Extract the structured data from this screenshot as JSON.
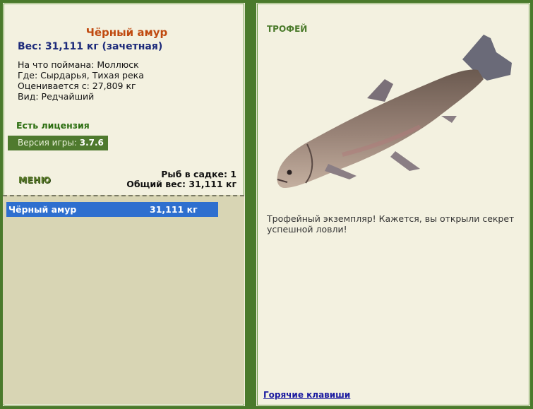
{
  "left": {
    "fish_name": "Чёрный амур",
    "weight_line": "Вес: 31,111 кг (зачетная)",
    "bait_line": "На что поймана: Моллюск",
    "location_line": "Где: Сырдарья, Тихая река",
    "estimated_line": "Оценивается с: 27,809 кг",
    "rarity_line": "Вид: Редчайший",
    "license": "Есть лицензия",
    "version_label": "Версия игры:",
    "version_value": "3.7.6",
    "menu_label": "МЕНЮ",
    "fish_count": "Рыб в садке: 1",
    "total_weight": "Общий вес: 31,111 кг",
    "catch_list": [
      {
        "name": "Чёрный амур",
        "weight": "31,111 кг"
      }
    ]
  },
  "right": {
    "trophy_label": "ТРОФЕЙ",
    "description": "Трофейный экземпляр! Кажется, вы открыли секрет успешной ловли!",
    "hotkeys_link": "Горячие клавиши"
  },
  "colors": {
    "frame": "#4a7a2c",
    "panel": "#f3f1e0",
    "selection": "#2e6fcf",
    "title": "#c04a10"
  }
}
